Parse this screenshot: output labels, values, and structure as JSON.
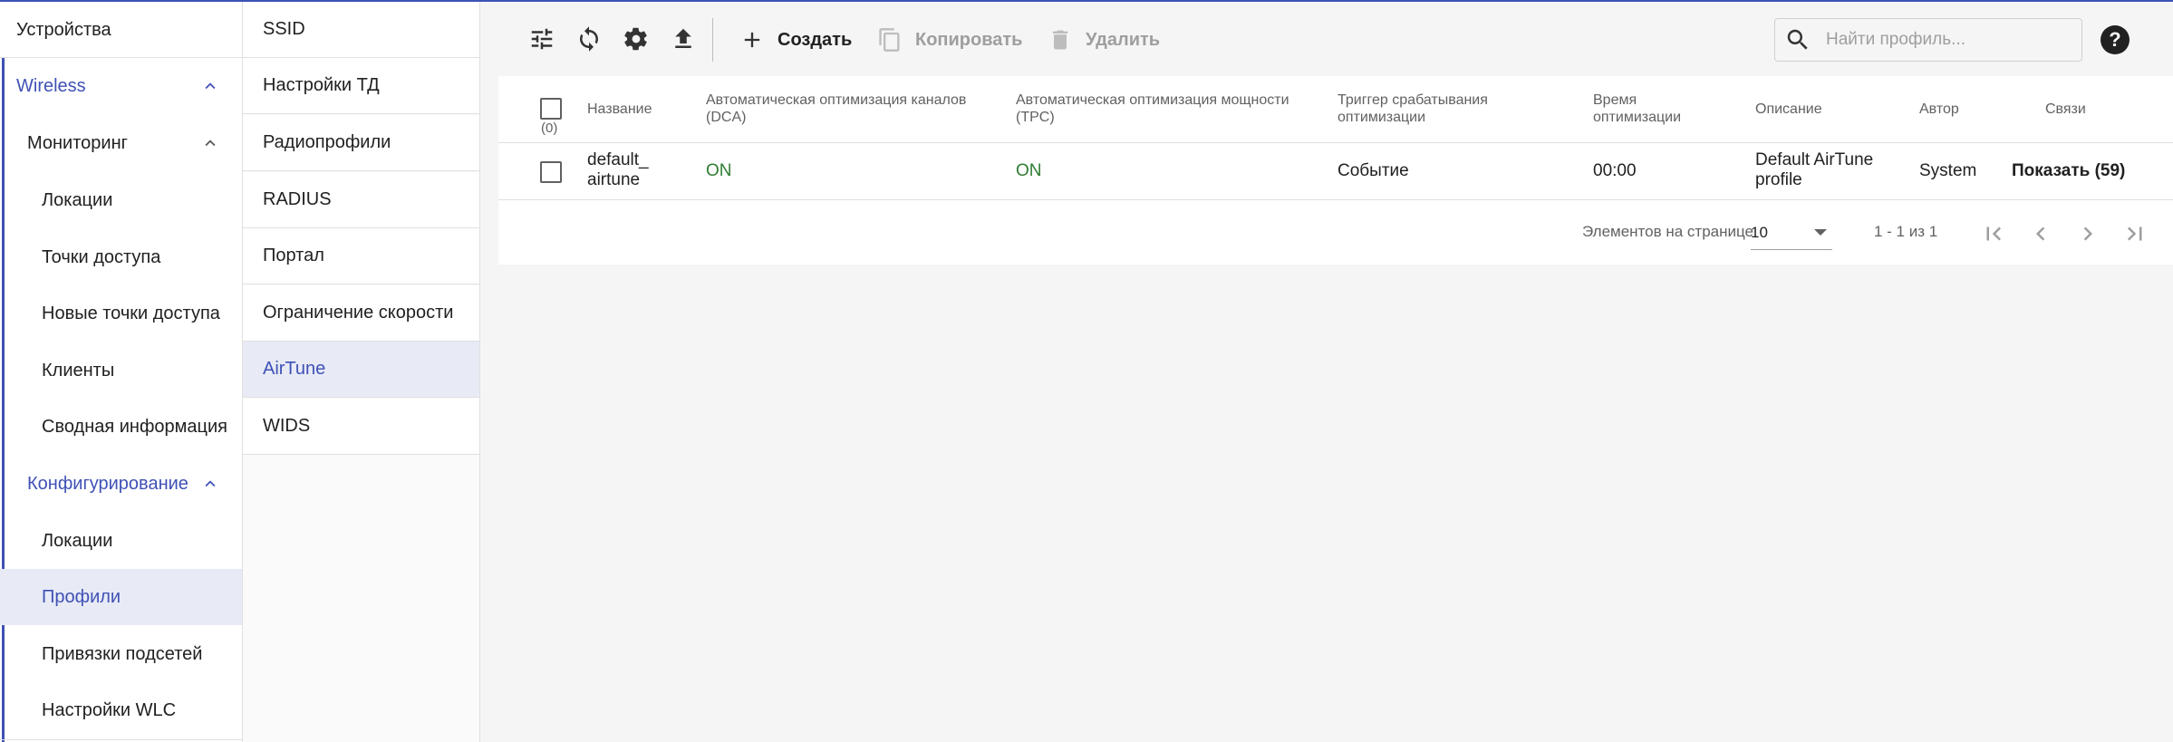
{
  "nav_primary": {
    "devices": "Устройства",
    "wireless": "Wireless",
    "monitoring": "Мониторинг",
    "monitoring_items": [
      "Локации",
      "Точки доступа",
      "Новые точки доступа",
      "Клиенты",
      "Сводная информация"
    ],
    "configuration": "Конфигурирование",
    "configuration_items": [
      "Локации",
      "Профили",
      "Привязки подсетей",
      "Настройки WLC"
    ],
    "accent_color": "#3f51b5"
  },
  "nav_profiles": {
    "items": [
      "SSID",
      "Настройки ТД",
      "Радиопрофили",
      "RADIUS",
      "Портал",
      "Ограничение скорости",
      "AirTune",
      "WIDS"
    ],
    "selected": "AirTune"
  },
  "toolbar": {
    "icons": [
      "tune-icon",
      "refresh-icon",
      "settings-icon",
      "upload-icon"
    ],
    "create_label": "Создать",
    "copy_label": "Копировать",
    "delete_label": "Удалить",
    "search_placeholder": "Найти профиль..."
  },
  "table": {
    "select_count": "(0)",
    "columns": {
      "name": "Название",
      "dca": "Автоматическая оптимизация каналов (DCA)",
      "tpc": "Автоматическая оптимизация мощности (TPC)",
      "trigger": "Триггер срабатывания оптимизации",
      "time": "Время оптимизации",
      "description": "Описание",
      "author": "Автор",
      "links": "Связи"
    },
    "rows": [
      {
        "name": "default_ airtune",
        "dca": "ON",
        "tpc": "ON",
        "trigger": "Событие",
        "time": "00:00",
        "description": "Default AirTune profile",
        "author": "System",
        "links": "Показать (59)"
      }
    ],
    "status_on_color": "#2e7d32"
  },
  "pagination": {
    "per_page_label": "Элементов на странице",
    "per_page_value": "10",
    "range": "1 - 1 из 1"
  }
}
